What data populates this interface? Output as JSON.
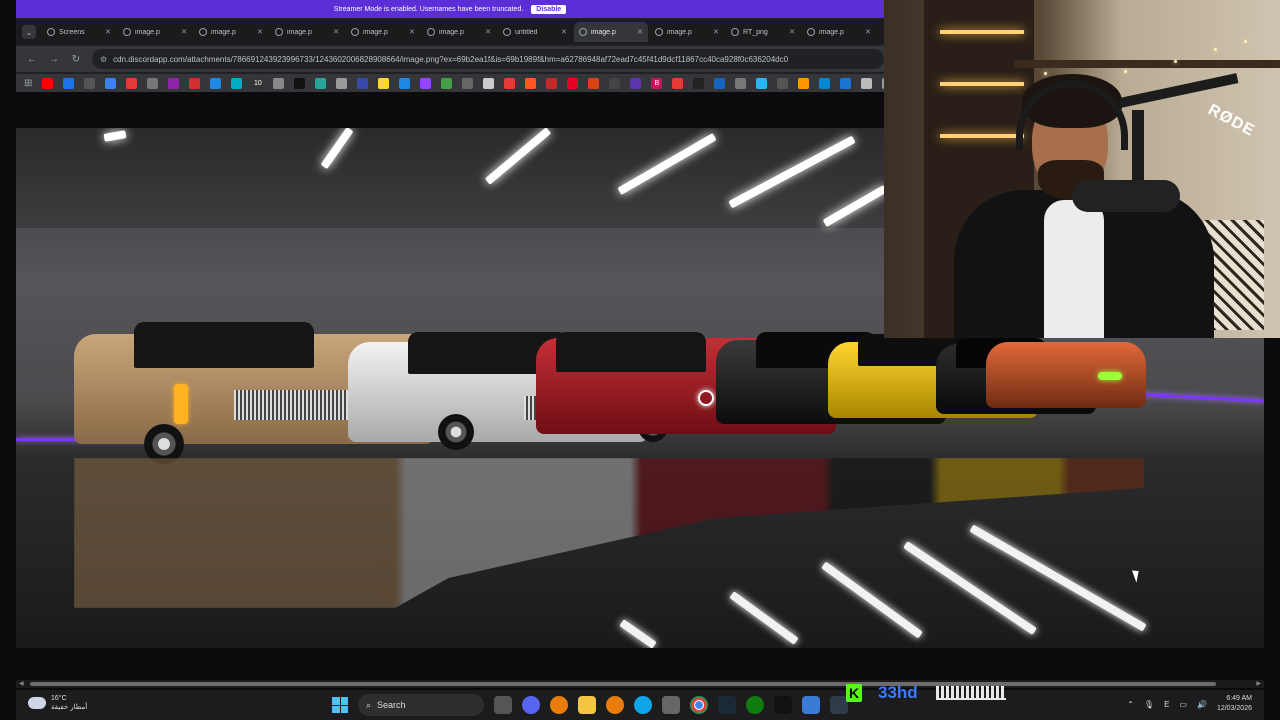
{
  "banner": {
    "text": "Streamer Mode is enabled. Usernames have been truncated.",
    "button_label": "Disable",
    "bg_color": "#5c2fd6"
  },
  "browser": {
    "tabs": [
      {
        "label": "Screens",
        "active": false
      },
      {
        "label": "image.p",
        "active": false
      },
      {
        "label": "image.p",
        "active": false
      },
      {
        "label": "image.p",
        "active": false
      },
      {
        "label": "image.p",
        "active": false
      },
      {
        "label": "image.p",
        "active": false
      },
      {
        "label": "untitled",
        "active": false
      },
      {
        "label": "image.p",
        "active": true
      },
      {
        "label": "image.p",
        "active": false
      },
      {
        "label": "RT_png",
        "active": false
      },
      {
        "label": "image.p",
        "active": false
      }
    ],
    "url": "cdn.discordapp.com/attachments/786691243923996733/1243602006828908664/image.png?ex=69b2ea1f&is=69b1989f&hm=a62786948af72ead7c45f41d9dcf11867cc40ca928f0c636204dc0"
  },
  "bookmarks": [
    {
      "icon": "youtube-icon",
      "color": "#ff0000",
      "text": ""
    },
    {
      "icon": "bookmark-icon",
      "color": "#1a73e8",
      "text": ""
    },
    {
      "icon": "bookmark-icon",
      "color": "#555",
      "text": ""
    },
    {
      "icon": "bookmark-icon",
      "color": "#3b82f6",
      "text": ""
    },
    {
      "icon": "bookmark-icon",
      "color": "#e53935",
      "text": ""
    },
    {
      "icon": "bookmark-icon",
      "color": "#777",
      "text": ""
    },
    {
      "icon": "bookmark-icon",
      "color": "#8e24aa",
      "text": ""
    },
    {
      "icon": "bookmark-icon",
      "color": "#d32f2f",
      "text": ""
    },
    {
      "icon": "bookmark-icon",
      "color": "#1e88e5",
      "text": ""
    },
    {
      "icon": "bookmark-icon",
      "color": "#00acc1",
      "text": ""
    },
    {
      "icon": "bookmark-icon",
      "color": "#333",
      "text": "10"
    },
    {
      "icon": "bookmark-icon",
      "color": "#888",
      "text": ""
    },
    {
      "icon": "tiktok-icon",
      "color": "#111",
      "text": ""
    },
    {
      "icon": "bookmark-icon",
      "color": "#26a69a",
      "text": ""
    },
    {
      "icon": "bookmark-icon",
      "color": "#999",
      "text": ""
    },
    {
      "icon": "bookmark-icon",
      "color": "#3949ab",
      "text": ""
    },
    {
      "icon": "bookmark-icon",
      "color": "#fdd835",
      "text": ""
    },
    {
      "icon": "bookmark-icon",
      "color": "#1e88e5",
      "text": ""
    },
    {
      "icon": "twitch-icon",
      "color": "#9146ff",
      "text": ""
    },
    {
      "icon": "bookmark-icon",
      "color": "#43a047",
      "text": ""
    },
    {
      "icon": "bookmark-icon",
      "color": "#666",
      "text": ""
    },
    {
      "icon": "bookmark-icon",
      "color": "#ccc",
      "text": ""
    },
    {
      "icon": "bookmark-icon",
      "color": "#e53935",
      "text": ""
    },
    {
      "icon": "bookmark-icon",
      "color": "#ff5722",
      "text": ""
    },
    {
      "icon": "bookmark-icon",
      "color": "#c62828",
      "text": ""
    },
    {
      "icon": "pinterest-icon",
      "color": "#e60023",
      "text": ""
    },
    {
      "icon": "bookmark-icon",
      "color": "#d84315",
      "text": ""
    },
    {
      "icon": "bookmark-icon",
      "color": "#444",
      "text": ""
    },
    {
      "icon": "bookmark-icon",
      "color": "#5e35b1",
      "text": ""
    },
    {
      "icon": "bookmark-icon",
      "color": "#c2185b",
      "text": "B"
    },
    {
      "icon": "bookmark-icon",
      "color": "#e53935",
      "text": ""
    },
    {
      "icon": "bookmark-icon",
      "color": "#222",
      "text": ""
    },
    {
      "icon": "bookmark-icon",
      "color": "#1565c0",
      "text": ""
    },
    {
      "icon": "bookmark-icon",
      "color": "#777",
      "text": ""
    },
    {
      "icon": "bookmark-icon",
      "color": "#29b6f6",
      "text": ""
    },
    {
      "icon": "bookmark-icon",
      "color": "#555",
      "text": ""
    },
    {
      "icon": "bookmark-icon",
      "color": "#ff9800",
      "text": ""
    },
    {
      "icon": "bookmark-icon",
      "color": "#0288d1",
      "text": ""
    },
    {
      "icon": "bookmark-icon",
      "color": "#1976d2",
      "text": ""
    },
    {
      "icon": "bookmark-icon",
      "color": "#bbb",
      "text": ""
    },
    {
      "icon": "bookmark-icon",
      "color": "#999",
      "text": ""
    },
    {
      "icon": "bookmark-icon",
      "color": "#5c6bc0",
      "text": ""
    }
  ],
  "webcam": {
    "mic_brand": "RØDE"
  },
  "taskbar": {
    "weather_temp": "16°C",
    "weather_desc": "أمطار خفيفة",
    "search_label": "Search",
    "time": "6:49 AM",
    "date": "12/03/2026",
    "lang": "E"
  },
  "overlay": {
    "k_label": "K",
    "text": "33hd"
  }
}
